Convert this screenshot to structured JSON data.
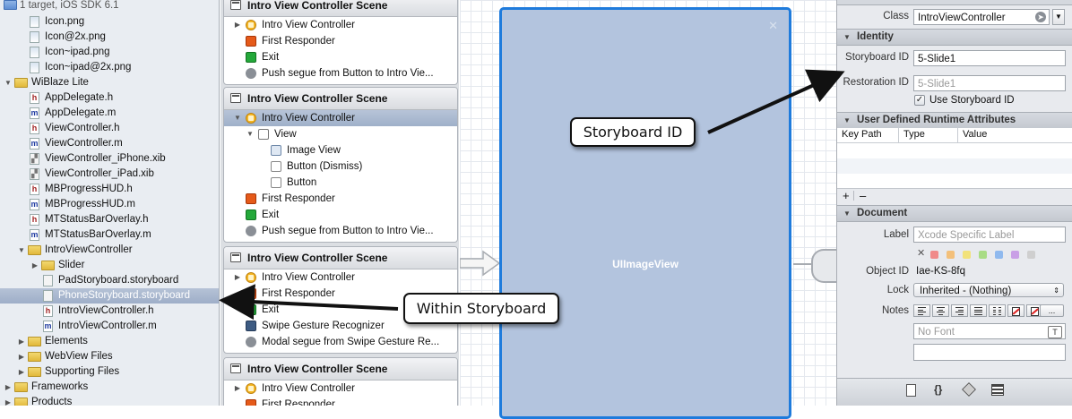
{
  "navigator": {
    "target_info": "1 target, iOS SDK 6.1",
    "items": [
      {
        "label": "Icon.png",
        "icon": "png-file-icon"
      },
      {
        "label": "Icon@2x.png",
        "icon": "png-file-icon"
      },
      {
        "label": "Icon~ipad.png",
        "icon": "png-file-icon"
      },
      {
        "label": "Icon~ipad@2x.png",
        "icon": "png-file-icon"
      },
      {
        "label": "WiBlaze Lite",
        "icon": "folder-icon"
      },
      {
        "label": "AppDelegate.h",
        "icon": "header-file-icon"
      },
      {
        "label": "AppDelegate.m",
        "icon": "implementation-file-icon"
      },
      {
        "label": "ViewController.h",
        "icon": "header-file-icon"
      },
      {
        "label": "ViewController.m",
        "icon": "implementation-file-icon"
      },
      {
        "label": "ViewController_iPhone.xib",
        "icon": "xib-file-icon"
      },
      {
        "label": "ViewController_iPad.xib",
        "icon": "xib-file-icon"
      },
      {
        "label": "MBProgressHUD.h",
        "icon": "header-file-icon"
      },
      {
        "label": "MBProgressHUD.m",
        "icon": "implementation-file-icon"
      },
      {
        "label": "MTStatusBarOverlay.h",
        "icon": "header-file-icon"
      },
      {
        "label": "MTStatusBarOverlay.m",
        "icon": "implementation-file-icon"
      },
      {
        "label": "IntroViewController",
        "icon": "folder-icon"
      },
      {
        "label": "Slider",
        "icon": "folder-icon"
      },
      {
        "label": "PadStoryboard.storyboard",
        "icon": "storyboard-file-icon"
      },
      {
        "label": "PhoneStoryboard.storyboard",
        "icon": "storyboard-file-icon",
        "selected": true
      },
      {
        "label": "IntroViewController.h",
        "icon": "header-file-icon"
      },
      {
        "label": "IntroViewController.m",
        "icon": "implementation-file-icon"
      },
      {
        "label": "Elements",
        "icon": "folder-icon"
      },
      {
        "label": "WebView Files",
        "icon": "folder-icon"
      },
      {
        "label": "Supporting Files",
        "icon": "folder-icon"
      },
      {
        "label": "Frameworks",
        "icon": "folder-icon"
      },
      {
        "label": "Products",
        "icon": "folder-icon"
      }
    ]
  },
  "outline": {
    "scenes": [
      {
        "title": "Intro View Controller Scene",
        "rows": [
          "Intro View Controller",
          "First Responder",
          "Exit",
          "Push segue from Button to Intro Vie..."
        ]
      },
      {
        "title": "Intro View Controller Scene",
        "rows": [
          "Intro View Controller",
          "View",
          "Image View",
          "Button (Dismiss)",
          "Button",
          "First Responder",
          "Exit",
          "Push segue from Button to Intro Vie..."
        ]
      },
      {
        "title": "Intro View Controller Scene",
        "rows": [
          "Intro View Controller",
          "First Responder",
          "Exit",
          "Swipe Gesture Recognizer",
          "Modal segue from Swipe Gesture Re..."
        ]
      },
      {
        "title": "Intro View Controller Scene",
        "rows": [
          "Intro View Controller",
          "First Responder"
        ]
      }
    ]
  },
  "canvas": {
    "image_view_label": "UIImageView",
    "close_glyph": "✕"
  },
  "inspector": {
    "class_label": "Class",
    "class_value": "IntroViewController",
    "identity_section": "Identity",
    "storyboard_id_label": "Storyboard ID",
    "storyboard_id_value": "5-Slide1",
    "restoration_id_label": "Restoration ID",
    "restoration_id_placeholder": "5-Slide1",
    "use_storyboard_id_label": "Use Storyboard ID",
    "use_storyboard_id_checked": true,
    "runtime_section": "User Defined Runtime Attributes",
    "col_key_path": "Key Path",
    "col_type": "Type",
    "col_value": "Value",
    "add_glyph": "+",
    "remove_glyph": "–",
    "document_section": "Document",
    "label_label": "Label",
    "label_placeholder": "Xcode Specific Label",
    "label_clear": "✕",
    "label_colors": [
      "#f08a8a",
      "#f3c07a",
      "#f2e27a",
      "#a9dc85",
      "#8fb9ee",
      "#c9a0e6",
      "#cfcfcf"
    ],
    "object_id_label": "Object ID",
    "object_id_value": "Iae-KS-8fq",
    "lock_label": "Lock",
    "lock_value": "Inherited - (Nothing)",
    "notes_label": "Notes",
    "font_placeholder": "No Font",
    "font_button": "T",
    "more_button": "..."
  },
  "annotations": {
    "storyboard_id": "Storyboard ID",
    "within_storyboard": "Within Storyboard"
  }
}
